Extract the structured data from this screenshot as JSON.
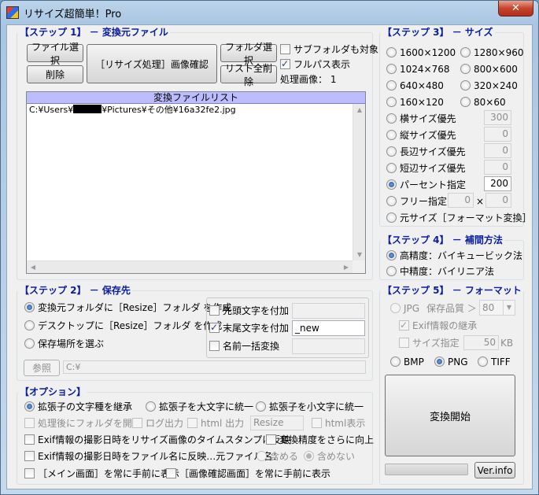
{
  "window": {
    "title": "リサイズ超簡単！Pro",
    "close_label": "✕"
  },
  "step1": {
    "legend": "【ステップ 1】 － 変換元ファイル",
    "file_select": "ファイル選択",
    "delete": "削除",
    "resize_confirm": "［リサイズ処理］画像確認",
    "folder_select": "フォルダ選択",
    "clear_all": "リスト全削除",
    "include_subfolders": "サブフォルダも対象",
    "show_full_path": "フルパス表示",
    "processed_count_label": "処理画像：",
    "processed_count_value": "1",
    "list_header": "変換ファイルリスト",
    "file_path_prefix": "C:¥Users¥",
    "file_path_suffix": "¥Pictures¥その他¥16a32fe2.jpg"
  },
  "step2": {
    "legend": "【ステップ 2】 － 保存先",
    "opt_source_folder": "変換元フォルダに［Resize］フォルダ を作成",
    "opt_desktop": "デスクトップに［Resize］フォルダ を作成",
    "opt_choose": "保存場所を選ぶ",
    "prefix_label": "先頭文字を付加",
    "prefix_value": "",
    "suffix_label": "末尾文字を付加",
    "suffix_value": "_new",
    "rename_label": "名前一括変換",
    "rename_value": "",
    "browse": "参照",
    "path_value": "C:¥"
  },
  "options": {
    "legend": "【オプション】",
    "ext_keep": "拡張子の文字種を継承",
    "ext_upper": "拡張子を大文字に統一",
    "ext_lower": "拡張子を小文字に統一",
    "open_folder": "処理後にフォルダを開く",
    "log_output": "ログ出力",
    "html_output": "html 出力",
    "html_name": "Resize",
    "html_show": "html表示",
    "exif_timestamp": "Exif情報の撮影日時をリサイズ画像のタイムスタンプに反映",
    "improve_precision": "変換精度をさらに向上",
    "exif_filename": "Exif情報の撮影日時をファイル名に反映…元ファイル名：",
    "include_orig": "含める",
    "exclude_orig": "含めない",
    "main_topmost": "［メイン画面］を常に手前に表示",
    "preview_topmost": "［画像確認画面］を常に手前に表示"
  },
  "step3": {
    "legend": "【ステップ 3】 － サイズ",
    "sizes": [
      "1600×1200",
      "1280×960",
      "1024×768",
      "800×600",
      "640×480",
      "320×240",
      "160×120",
      "80×60"
    ],
    "width_priority": "横サイズ優先",
    "width_value": "300",
    "height_priority": "縦サイズ優先",
    "height_value": "0",
    "long_priority": "長辺サイズ優先",
    "long_value": "0",
    "short_priority": "短辺サイズ優先",
    "short_value": "0",
    "percent": "パーセント指定",
    "percent_value": "200",
    "free": "フリー指定",
    "free_w": "0",
    "free_x": "×",
    "free_h": "0",
    "original": "元サイズ［フォーマット変換］"
  },
  "step4": {
    "legend": "【ステップ 4】 － 補間方法",
    "high": "高精度：バイキュービック法",
    "mid": "中精度：バイリニア法"
  },
  "step5": {
    "legend": "【ステップ 5】 － フォーマット",
    "jpg": "JPG",
    "quality_label": "保存品質 ＞",
    "quality_value": "80",
    "exif_keep": "Exif情報の継承",
    "size_spec": "サイズ指定",
    "size_value": "50",
    "size_unit": "KB",
    "bmp": "BMP",
    "png": "PNG",
    "tiff": "TIFF",
    "convert": "変換開始",
    "ver_info": "Ver.info"
  }
}
